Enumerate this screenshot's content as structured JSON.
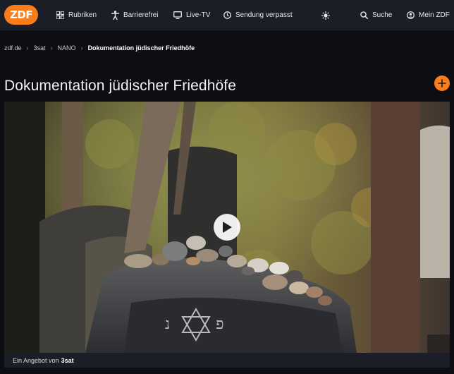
{
  "header": {
    "logo_text": "ZDF",
    "nav": {
      "rubriken": "Rubriken",
      "barrierefrei": "Barrierefrei",
      "livetv": "Live-TV",
      "verpasst": "Sendung verpasst",
      "suche": "Suche",
      "mein": "Mein ZDF"
    }
  },
  "breadcrumb": {
    "items": [
      "zdf.de",
      "3sat",
      "NANO"
    ],
    "current": "Dokumentation jüdischer Friedhöfe"
  },
  "page": {
    "title": "Dokumentation jüdischer Friedhöfe"
  },
  "video": {
    "provider_prefix": "Ein Angebot von",
    "provider_name": "3sat"
  },
  "colors": {
    "accent": "#fa7d19",
    "header_bg": "#1b1e26",
    "page_bg": "#0c0e14"
  },
  "icons": {
    "rubriken": "grid-icon",
    "barrierefrei": "accessibility-icon",
    "livetv": "tv-icon",
    "verpasst": "clock-icon",
    "theme": "sun-icon",
    "suche": "search-icon",
    "mein": "user-icon",
    "add": "plus-icon",
    "play": "play-icon"
  }
}
